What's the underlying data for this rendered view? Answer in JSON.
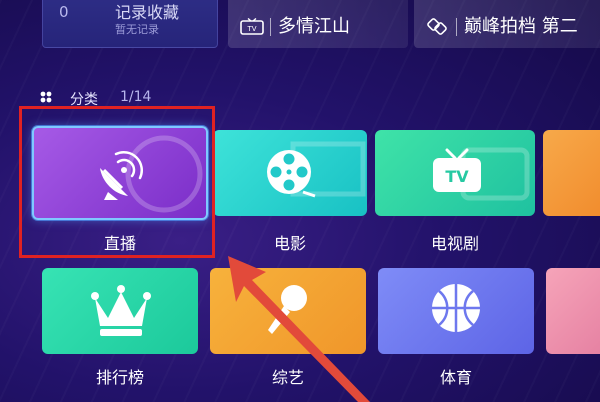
{
  "history": {
    "records": {
      "count_prefix": "0",
      "title": "记录收藏",
      "subtitle": "暂无记录"
    },
    "items": [
      {
        "title": "多情江山",
        "icon": "tv-icon"
      },
      {
        "title": "巅峰拍档 第二",
        "icon": "link-icon"
      }
    ]
  },
  "category": {
    "label": "分类",
    "page": "1/14",
    "icon": "grid-icon"
  },
  "tiles": [
    {
      "label": "直播",
      "icon": "satellite-dish-icon",
      "selected": true,
      "color": "#9a4fe0"
    },
    {
      "label": "电影",
      "icon": "film-reel-icon",
      "color": "#2fd4d0"
    },
    {
      "label": "电视剧",
      "icon": "tv-icon",
      "color": "#33d6a6"
    },
    {
      "label": "排行榜",
      "icon": "crown-icon",
      "color": "#2cd6a8"
    },
    {
      "label": "综艺",
      "icon": "microphone-icon",
      "color": "#f4a333"
    },
    {
      "label": "体育",
      "icon": "basketball-icon",
      "color": "#6f78ef"
    }
  ],
  "annotation": {
    "highlight_color": "#e02222",
    "arrow": "pointing-to-live"
  }
}
